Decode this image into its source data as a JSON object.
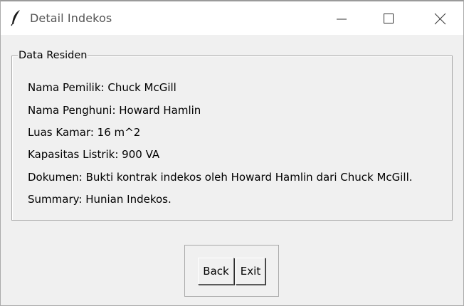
{
  "window": {
    "title": "Detail Indekos",
    "app_icon": "feather-icon",
    "controls": {
      "minimize": "minimize-icon",
      "maximize": "maximize-icon",
      "close": "close-icon"
    }
  },
  "data_frame": {
    "legend": "Data Residen",
    "lines": {
      "owner": "Nama Pemilik: Chuck McGill",
      "tenant": "Nama Penghuni: Howard Hamlin",
      "room_area": "Luas Kamar: 16 m^2",
      "power_capacity": "Kapasitas Listrik: 900 VA",
      "document": "Dokumen: Bukti kontrak indekos oleh Howard Hamlin dari Chuck McGill.",
      "summary": "Summary: Hunian Indekos."
    }
  },
  "buttons": {
    "back_label": "Back",
    "exit_label": "Exit"
  },
  "colors": {
    "window_bg": "#f0f0f0",
    "titlebar_bg": "#ffffff",
    "title_text": "#555555",
    "frame_border": "#a9a9a9"
  }
}
